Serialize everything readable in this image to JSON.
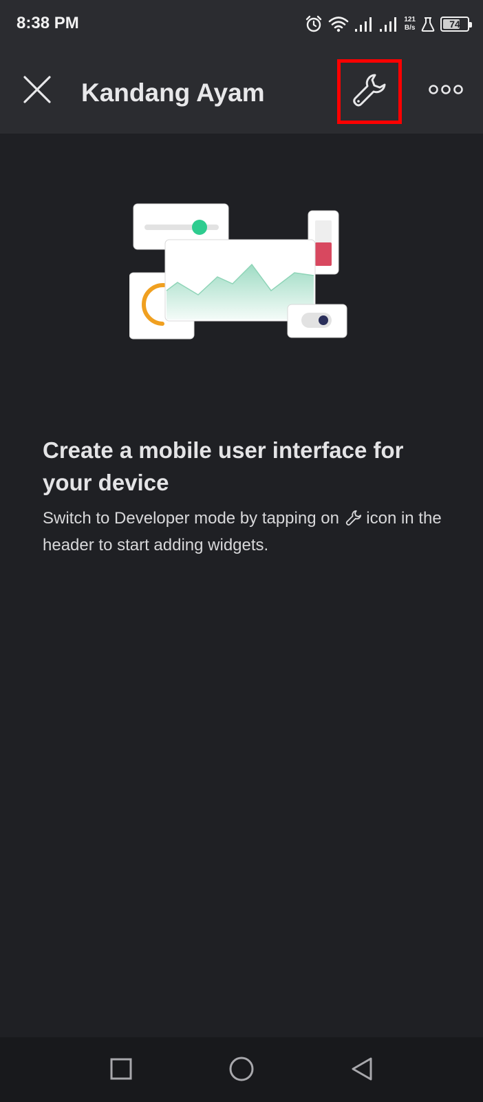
{
  "status_bar": {
    "time": "8:38 PM",
    "net_speed_value": "121",
    "net_speed_unit": "B/s",
    "battery_level": "74",
    "icons": [
      "alarm-icon",
      "wifi-icon",
      "signal-icon",
      "signal-icon",
      "lab-icon",
      "battery-icon"
    ]
  },
  "header": {
    "title": "Kandang Ayam",
    "close_icon": "close-icon",
    "developer_mode_icon": "wrench-icon",
    "more_icon": "more-horizontal-icon",
    "highlight_color": "#ff0000"
  },
  "illustration": {
    "slider_color": "#2ecc8f",
    "gauge_color": "#f0a020",
    "level_color": "#d8485f",
    "switch_knob_color": "#2a2f5a"
  },
  "empty_state": {
    "heading": "Create a mobile user interface for your device",
    "body_prefix": "Switch to Developer mode by tapping on",
    "body_suffix": "icon in the header to start adding widgets."
  },
  "nav_bar": {
    "buttons": [
      "recent-apps-icon",
      "home-icon",
      "back-icon"
    ]
  },
  "colors": {
    "background": "#1f2024",
    "header_background": "#2b2c30",
    "nav_background": "#18191c",
    "text": "#e4e4e6"
  }
}
